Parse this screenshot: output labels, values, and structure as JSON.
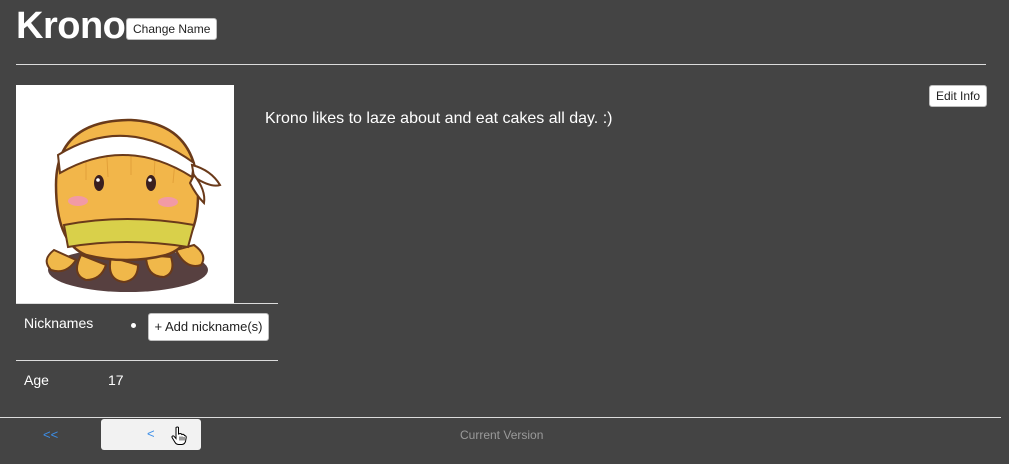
{
  "header": {
    "title": "Krono",
    "change_name_label": "Change Name"
  },
  "main": {
    "edit_info_label": "Edit Info",
    "description": "Krono likes to laze about and eat cakes all day. :)"
  },
  "details": {
    "nicknames_label": "Nicknames",
    "add_nickname_label": "+ Add nickname(s)",
    "age_label": "Age",
    "age_value": "17"
  },
  "footer": {
    "first_label": "<<",
    "prev_label": "<",
    "status": "Current Version"
  },
  "colors": {
    "background": "#444444",
    "link": "#3c8ee8",
    "status_text": "#9a9a9a"
  },
  "icons": {
    "cursor": "hand-pointer-icon",
    "bullet": "bullet-icon"
  }
}
